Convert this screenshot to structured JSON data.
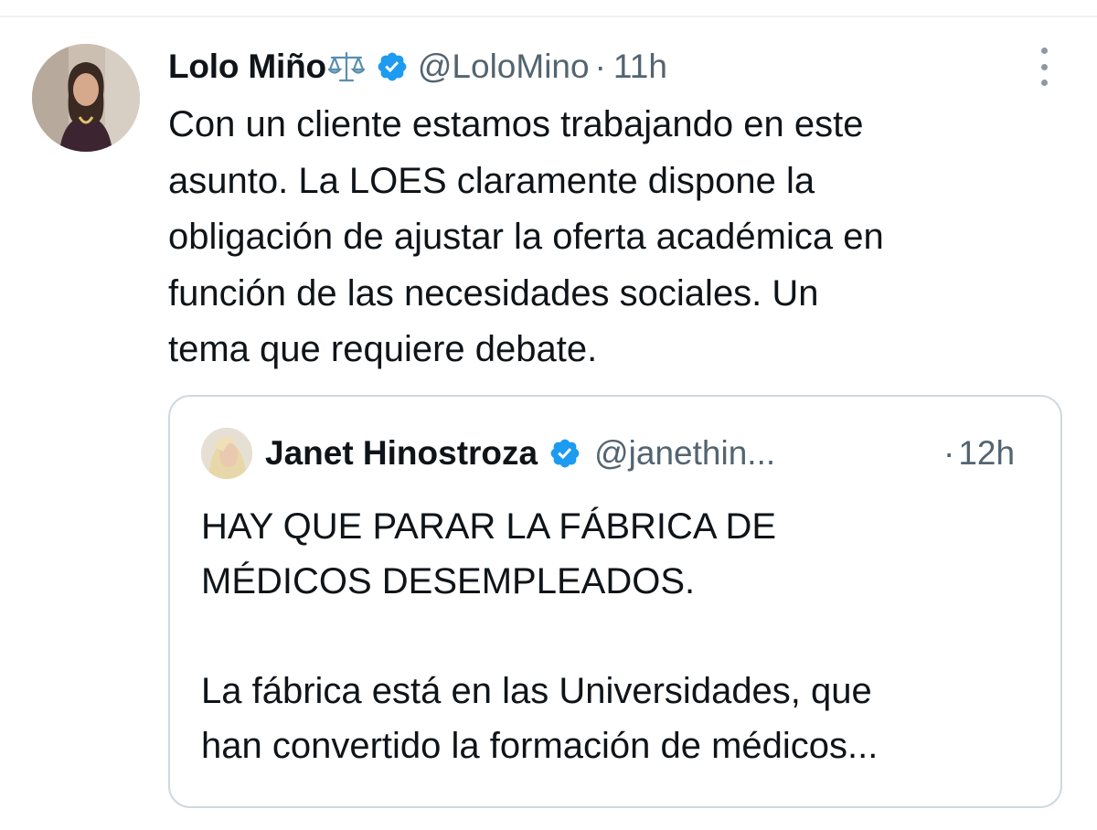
{
  "tweet": {
    "author_name": "Lolo Miño",
    "author_handle": "@LoloMino",
    "separator": "·",
    "time": "11h",
    "name_emoji": "scales-icon",
    "text_lines": [
      "Con un cliente estamos trabajando en este",
      "asunto. La LOES claramente dispone la",
      "obligación de ajustar la oferta académica en",
      "función de las necesidades sociales. Un",
      "tema que requiere debate."
    ]
  },
  "quote": {
    "author_name": "Janet Hinostroza",
    "author_handle": "@janethin...",
    "separator": "·",
    "time": "12h",
    "paragraphs": [
      [
        "HAY QUE PARAR LA FÁBRICA DE",
        "MÉDICOS DESEMPLEADOS."
      ],
      [
        "La fábrica está en las Universidades, que",
        "han convertido la formación de médicos..."
      ]
    ]
  },
  "icons": {
    "verified": "verified-badge-icon",
    "more": "more-options-icon"
  },
  "colors": {
    "verified_blue": "#1d9bf0",
    "text_primary": "#0f1419",
    "text_secondary": "#536471",
    "border": "#cfd9de"
  }
}
